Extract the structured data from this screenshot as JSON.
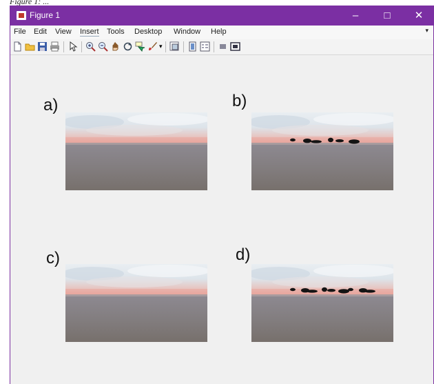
{
  "caption": "Figure 1: ...",
  "window": {
    "title": "Figure 1",
    "minimize_glyph": "–",
    "maximize_glyph": "□",
    "close_glyph": "✕",
    "accent": "#7b2fa3"
  },
  "menu": {
    "items": [
      "File",
      "Edit",
      "View",
      "Insert",
      "Tools",
      "Desktop",
      "Window",
      "Help"
    ],
    "overflow_glyph": "▾"
  },
  "toolbar": {
    "icons": [
      "new-figure-icon",
      "open-file-icon",
      "save-icon",
      "print-icon",
      "select-arrow-icon",
      "zoom-in-icon",
      "zoom-out-icon",
      "pan-icon",
      "rotate-3d-icon",
      "data-cursor-icon",
      "brush-icon",
      "link-plot-icon",
      "colorbar-icon",
      "legend-icon",
      "hide-plot-tools-icon",
      "show-plot-tools-icon"
    ]
  },
  "subplots": [
    {
      "label": "a)",
      "blobs": 0
    },
    {
      "label": "b)",
      "blobs": 6
    },
    {
      "label": "c)",
      "blobs": 0
    },
    {
      "label": "d)",
      "blobs": 9
    }
  ]
}
